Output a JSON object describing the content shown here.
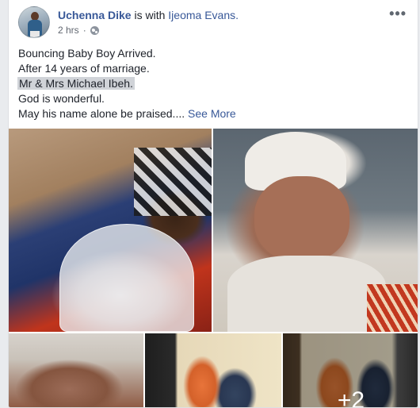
{
  "post": {
    "author": "Uchenna Dike",
    "with_text": "is with",
    "tagged": "Ijeoma Evans.",
    "time": "2 hrs",
    "audience_icon": "globe-icon",
    "menu_icon": "more-options-icon",
    "menu_glyph": "•••",
    "lines": [
      "Bouncing Baby Boy Arrived.",
      "After 14 years of marriage.",
      "Mr & Mrs Michael Ibeh.",
      "God is wonderful.",
      "May his name alone be praised...."
    ],
    "see_more": "See More",
    "photos_more_count": "+2"
  },
  "colors": {
    "link": "#385898",
    "text": "#1d2129",
    "meta": "#616770",
    "highlight": "#d0d3d8"
  }
}
